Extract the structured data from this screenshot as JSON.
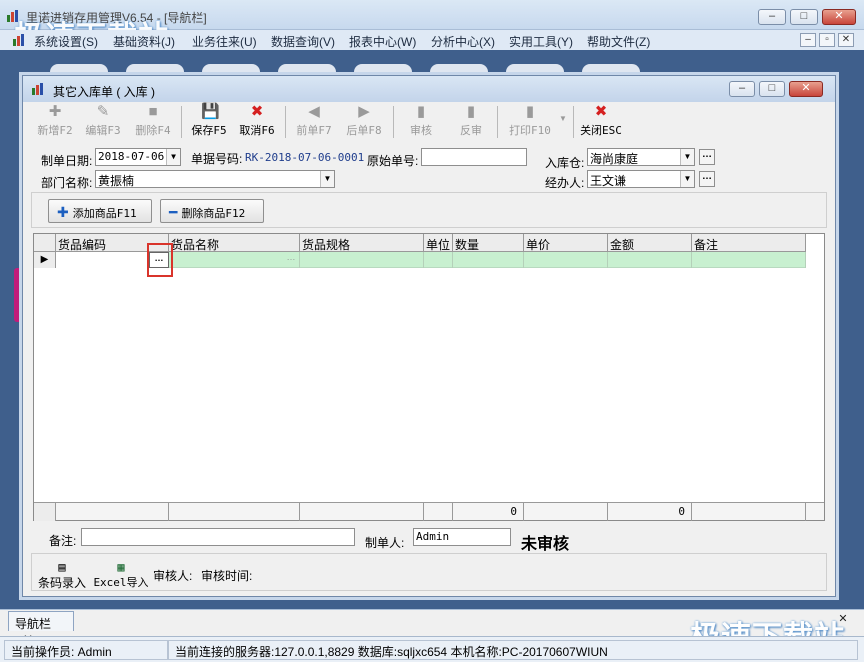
{
  "app": {
    "title": "里诺进销存用管理V6.54 - [导航栏]",
    "watermark": "极速下载站"
  },
  "menu": {
    "items": [
      "系统设置(S)",
      "基础资料(J)",
      "业务往来(U)",
      "数据查询(V)",
      "报表中心(W)",
      "分析中心(X)",
      "实用工具(Y)",
      "帮助文件(Z)"
    ]
  },
  "dialog": {
    "title": "其它入库单 ( 入库 )",
    "toolbar": {
      "new": "新增F2",
      "edit": "编辑F3",
      "delete": "删除F4",
      "save": "保存F5",
      "cancel": "取消F6",
      "prev": "前单F7",
      "next": "后单F8",
      "audit": "审核",
      "unaudit": "反审",
      "print": "打印F10",
      "close": "关闭ESC"
    },
    "header": {
      "date_label": "制单日期:",
      "date_value": "2018-07-06",
      "doc_no_label": "单据号码:",
      "doc_no_value": "RK-2018-07-06-0001",
      "orig_no_label": "原始单号:",
      "orig_no_value": "",
      "warehouse_label": "入库仓:",
      "warehouse_value": "海尚康庭",
      "dept_label": "部门名称:",
      "dept_value": "黄振楠",
      "handler_label": "经办人:",
      "handler_value": "王文谦"
    },
    "buttons": {
      "add_product": "添加商品F11",
      "delete_product": "删除商品F12"
    },
    "grid": {
      "columns": [
        "货品编码",
        "货品名称",
        "货品规格",
        "单位",
        "数量",
        "单价",
        "金额",
        "备注"
      ],
      "row": {
        "code": "",
        "name": ""
      },
      "footer": {
        "qty_total": "0",
        "amount_total": "0"
      }
    },
    "footer": {
      "remark_label": "备注:",
      "remark_value": "",
      "creator_label": "制单人:",
      "creator_value": "Admin",
      "status": "未审核",
      "barcode_import": "条码录入",
      "excel_import": "Excel导入",
      "auditor_label": "审核人:",
      "audit_time_label": "审核时间:"
    }
  },
  "nav_tab": {
    "label": "导航栏",
    "close": "✕"
  },
  "status": {
    "operator": "当前操作员: Admin",
    "server": "当前连接的服务器:127.0.0.1,8829 数据库:sqljxc654 本机名称:PC-20170607WIUN"
  },
  "colors": {
    "grid_row": "#c8f0d0",
    "highlight": "#d9342b",
    "doc_no": "#1f3d8c"
  }
}
